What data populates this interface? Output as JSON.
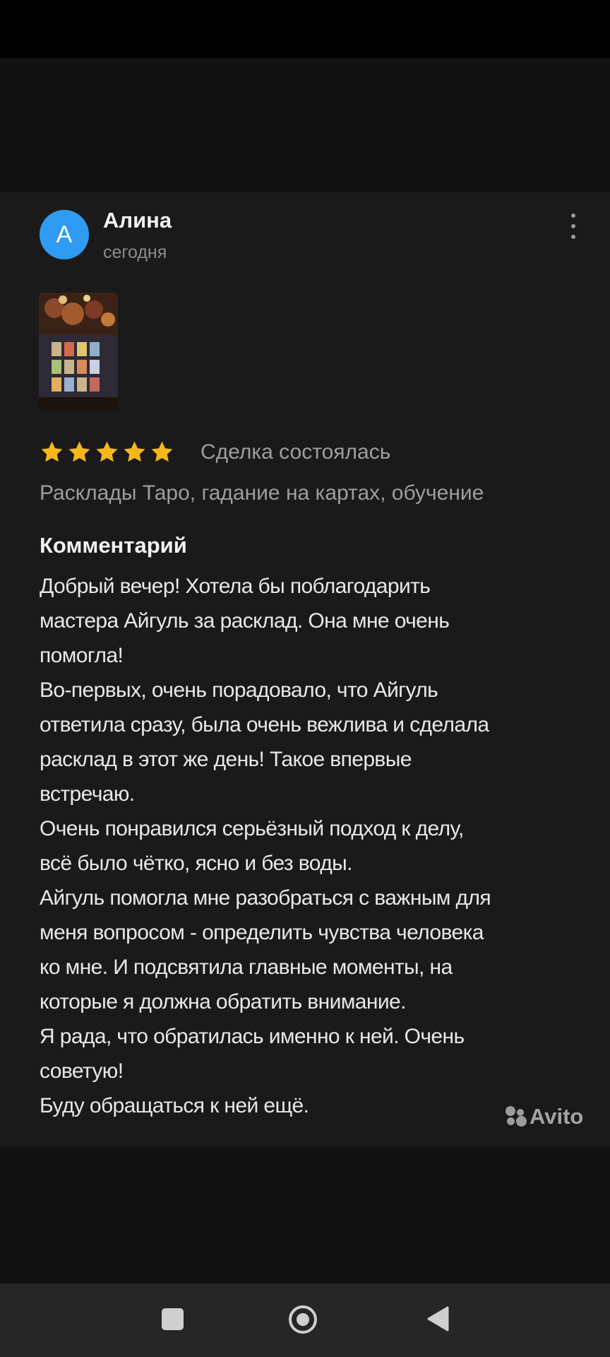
{
  "review": {
    "avatar_letter": "A",
    "author": "Алина",
    "date": "сегодня",
    "rating": 5,
    "rating_max": 5,
    "deal_status": "Сделка состоялась",
    "service": "Расклады Таро, гадание на картах, обучение",
    "comment_heading": "Комментарий",
    "comment_lines": [
      "Добрый вечер! Хотела бы поблагодарить",
      "мастера Айгуль за расклад. Она мне очень",
      "помогла!",
      "Во-первых, очень порадовало, что Айгуль",
      "ответила сразу, была очень вежлива и сделала",
      "расклад в этот же день! Такое впервые",
      "встречаю.",
      "Очень понравился серьёзный подход к делу,",
      "всё было чётко, ясно и без воды.",
      "Айгуль помогла мне разобраться с важным для",
      "меня вопросом - определить чувства человека",
      "ко мне. И подсвятила главные моменты, на",
      "которые я должна обратить внимание.",
      "Я рада, что обратилась именно к ней. Очень",
      "советую!",
      "Буду обращаться к ней ещё."
    ]
  },
  "watermark": "Avito",
  "colors": {
    "avatar": "#2f9bf2",
    "star": "#f5b81c",
    "card_background": "#1a1a1a",
    "nav_bar": "#262626"
  },
  "icons": {
    "more": "more-vertical-icon",
    "star": "star-icon",
    "nav_recents": "recents-square-icon",
    "nav_home": "home-circle-icon",
    "nav_back": "back-triangle-icon"
  }
}
